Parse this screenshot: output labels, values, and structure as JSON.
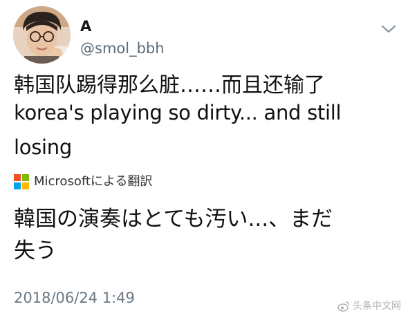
{
  "user": {
    "display_name": "A",
    "handle": "@smol_bbh"
  },
  "tweet": {
    "lines": [
      "韩国队踢得那么脏……而且还输了",
      "korea's playing so dirty... and still",
      "losing"
    ]
  },
  "translation": {
    "provider_label": "Microsoftによる翻訳",
    "lines": [
      "韓国の演奏はとても汚い...、まだ",
      "失う"
    ]
  },
  "timestamp": "2018/06/24 1:49",
  "watermark": {
    "text": "头条中文网"
  },
  "colors": {
    "handle": "#5b6b78",
    "timestamp": "#6a7884",
    "ms_red": "#f25022",
    "ms_green": "#7fba00",
    "ms_blue": "#00a4ef",
    "ms_yellow": "#ffb900"
  },
  "icons": {
    "menu": "chevron-down-icon",
    "translator": "microsoft-logo-icon",
    "watermark": "weibo-icon"
  }
}
